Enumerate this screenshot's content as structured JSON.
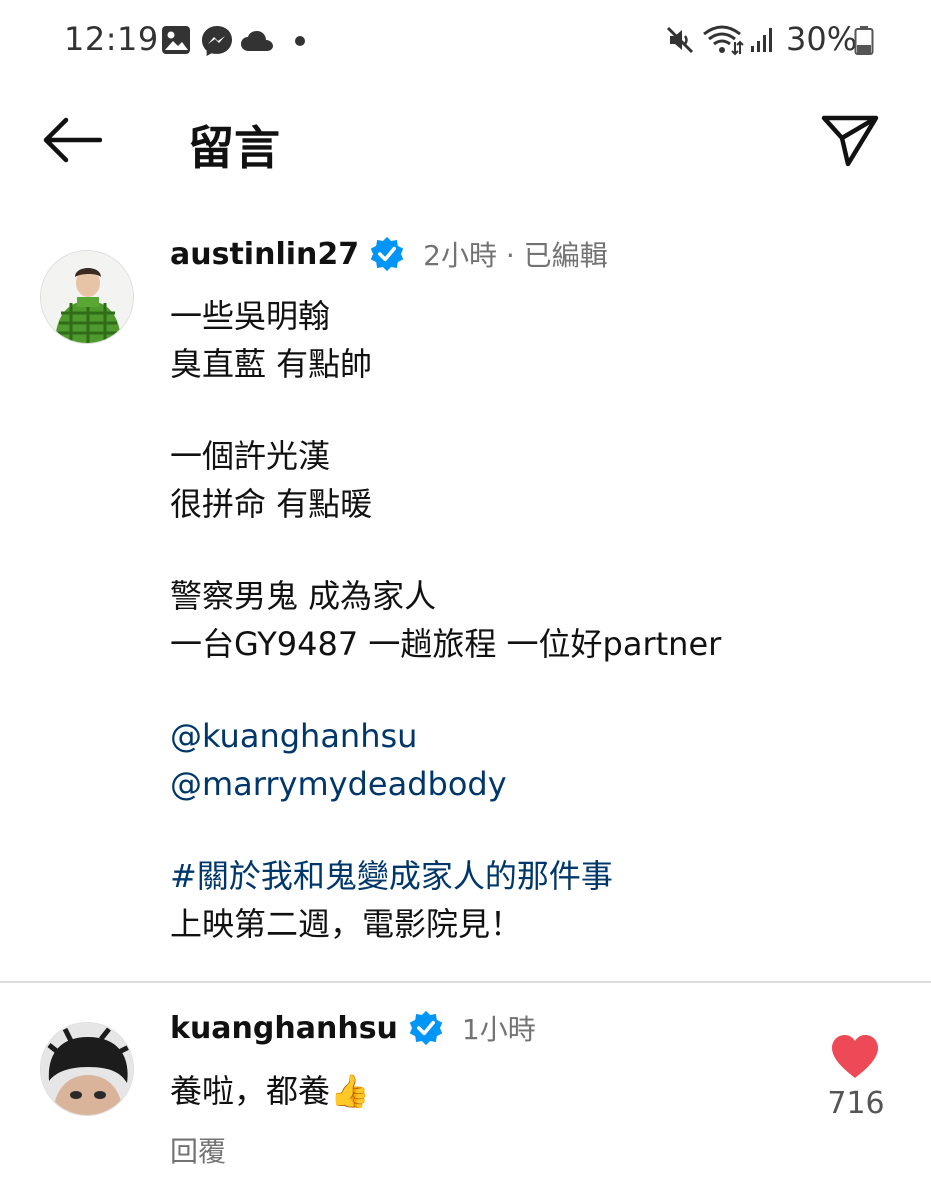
{
  "status_bar": {
    "time": "12:19",
    "left_icons": [
      "gallery-icon",
      "messenger-icon",
      "cloud-icon",
      "notification-dot-icon"
    ],
    "right_icons": [
      "mute-icon",
      "wifi-icon",
      "signal-icon",
      "battery-icon"
    ],
    "battery_percent": "30%"
  },
  "header": {
    "title": "留言",
    "back_icon": "arrow-left-icon",
    "share_icon": "send-icon"
  },
  "post": {
    "username": "austinlin27",
    "verified": true,
    "meta": "2小時 · 已編輯",
    "lines": [
      "一些吳明翰",
      "臭直藍 有點帥",
      "一個許光漢",
      "很拼命 有點暖",
      "警察男鬼 成為家人",
      "一台GY9487 一趟旅程 一位好partner",
      "@kuanghanhsu",
      "@marrymydeadbody",
      "#關於我和鬼變成家人的那件事",
      "上映第二週，電影院見！"
    ]
  },
  "reply": {
    "username": "kuanghanhsu",
    "verified": true,
    "time": "1小時",
    "text": "養啦，都養",
    "emoji": "👍",
    "reply_label": "回覆",
    "like_count": "716",
    "liked": true
  },
  "colors": {
    "text": "#111111",
    "muted": "#737373",
    "link": "#00376b",
    "verified": "#0095f6",
    "like": "#ed4956",
    "divider": "#dbdbdb"
  }
}
